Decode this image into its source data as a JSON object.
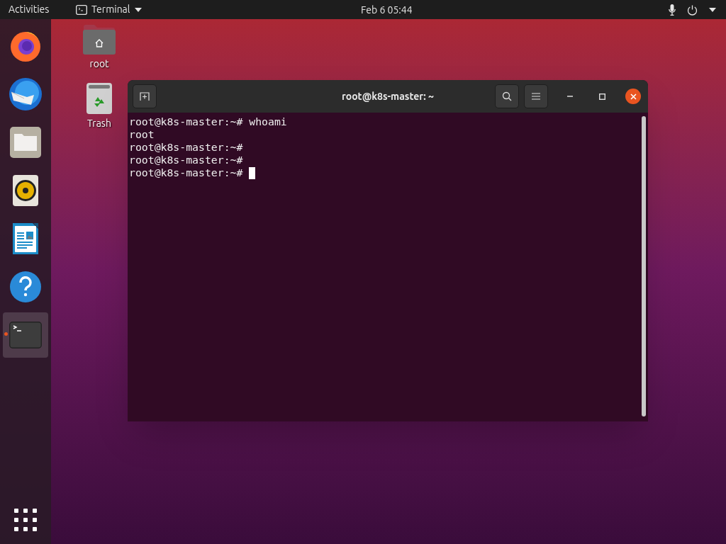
{
  "top_bar": {
    "activities": "Activities",
    "app_menu": "Terminal",
    "clock": "Feb 6  05:44"
  },
  "dock": {
    "items": [
      {
        "kind": "firefox",
        "running": false
      },
      {
        "kind": "thunderbird",
        "running": false
      },
      {
        "kind": "files",
        "running": false
      },
      {
        "kind": "rhythmbox",
        "running": false
      },
      {
        "kind": "writer",
        "running": false
      },
      {
        "kind": "help",
        "running": false
      },
      {
        "kind": "terminal",
        "running": true
      }
    ]
  },
  "desktop_icons": [
    {
      "kind": "home",
      "label": "root"
    },
    {
      "kind": "trash",
      "label": "Trash"
    }
  ],
  "terminal": {
    "title": "root@k8s-master: ~",
    "lines": [
      {
        "text": "root@k8s-master:~# whoami",
        "cursor": false
      },
      {
        "text": "root",
        "cursor": false
      },
      {
        "text": "root@k8s-master:~#",
        "cursor": false
      },
      {
        "text": "root@k8s-master:~#",
        "cursor": false
      },
      {
        "text": "root@k8s-master:~# ",
        "cursor": true
      }
    ]
  }
}
